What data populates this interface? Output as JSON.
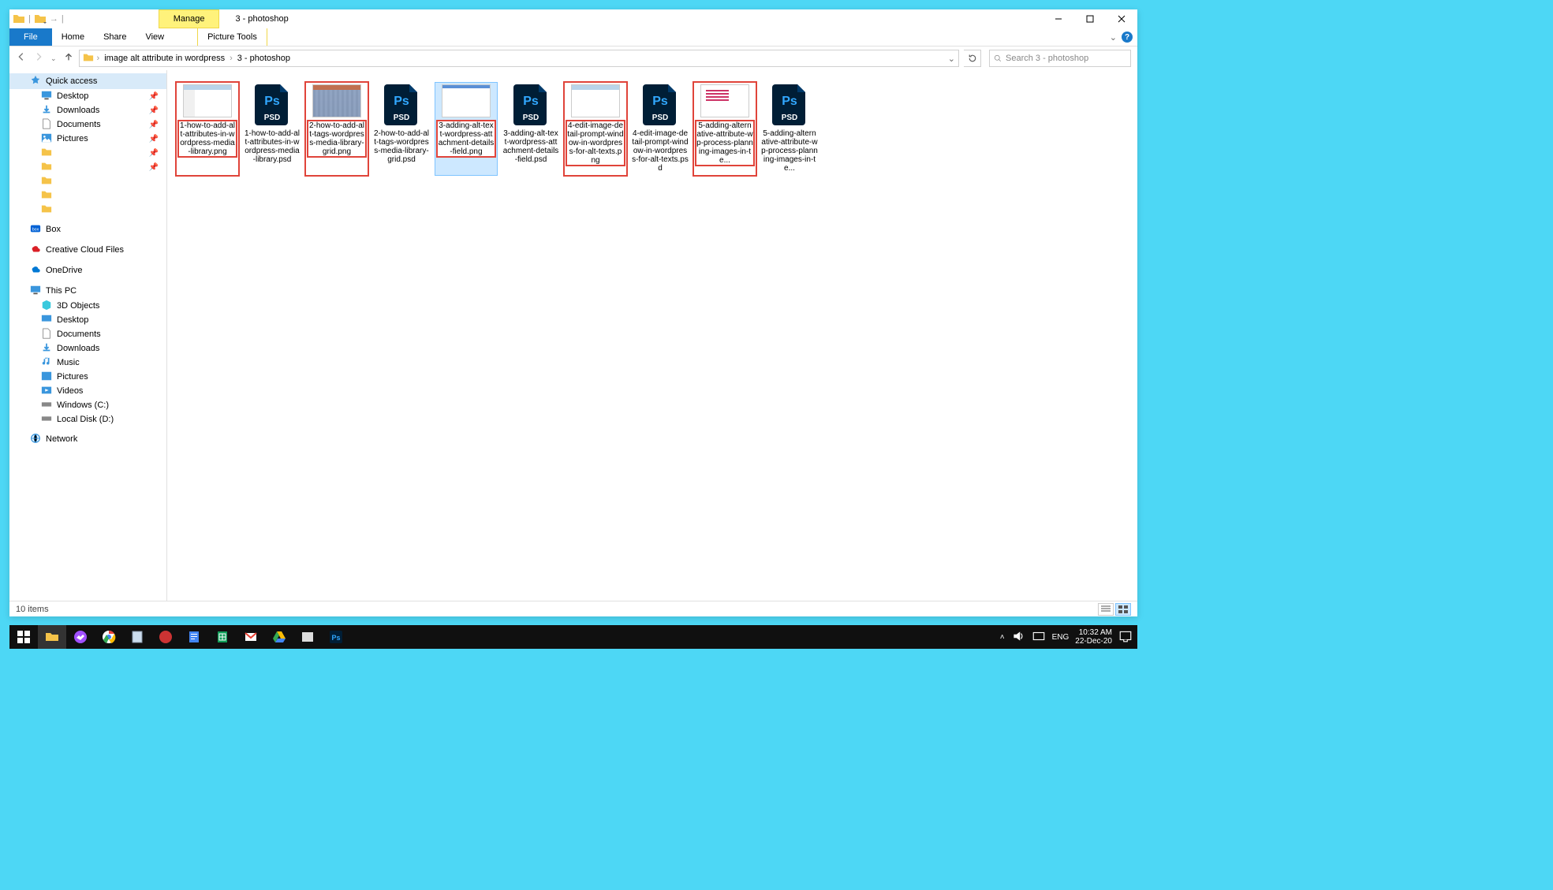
{
  "titlebar": {
    "manage_tab": "Manage",
    "window_title": "3 - photoshop"
  },
  "ribbon": {
    "file": "File",
    "home": "Home",
    "share": "Share",
    "view": "View",
    "picture_tools": "Picture Tools"
  },
  "breadcrumb": {
    "crumb1": "image alt attribute in wordpress",
    "crumb2": "3 - photoshop"
  },
  "search": {
    "placeholder": "Search 3 - photoshop"
  },
  "navpane": {
    "quick_access": "Quick access",
    "desktop": "Desktop",
    "downloads": "Downloads",
    "documents": "Documents",
    "pictures": "Pictures",
    "box": "Box",
    "creative_cloud": "Creative Cloud Files",
    "onedrive": "OneDrive",
    "this_pc": "This PC",
    "objects_3d": "3D Objects",
    "desktop2": "Desktop",
    "documents2": "Documents",
    "downloads2": "Downloads",
    "music": "Music",
    "pictures2": "Pictures",
    "videos": "Videos",
    "windows_c": "Windows (C:)",
    "local_d": "Local Disk (D:)",
    "network": "Network"
  },
  "files": [
    {
      "name": "1-how-to-add-alt-attributes-in-wordpress-media-library.png",
      "type": "png",
      "highlight": true,
      "thumb": "t1"
    },
    {
      "name": "1-how-to-add-alt-attributes-in-wordpress-media-library.psd",
      "type": "psd",
      "highlight": false
    },
    {
      "name": "2-how-to-add-alt-tags-wordpress-media-library-grid.png",
      "type": "png",
      "highlight": true,
      "thumb": "t2"
    },
    {
      "name": "2-how-to-add-alt-tags-wordpress-media-library-grid.psd",
      "type": "psd",
      "highlight": false
    },
    {
      "name": "3-adding-alt-text-wordpress-attachment-details-field.png",
      "type": "png",
      "highlight": true,
      "thumb": "t3",
      "selected": true
    },
    {
      "name": "3-adding-alt-text-wordpress-attachment-details-field.psd",
      "type": "psd",
      "highlight": false
    },
    {
      "name": "4-edit-image-detail-prompt-window-in-wordpress-for-alt-texts.png",
      "type": "png",
      "highlight": true,
      "thumb": "t4"
    },
    {
      "name": "4-edit-image-detail-prompt-window-in-wordpress-for-alt-texts.psd",
      "type": "psd",
      "highlight": false
    },
    {
      "name": "5-adding-alternative-attribute-wp-process-planning-images-in-te...",
      "type": "png",
      "highlight": true,
      "thumb": "t5"
    },
    {
      "name": "5-adding-alternative-attribute-wp-process-planning-images-in-te...",
      "type": "psd",
      "highlight": false
    }
  ],
  "statusbar": {
    "item_count": "10 items"
  },
  "taskbar": {
    "lang": "ENG",
    "time": "10:32 AM",
    "date": "22-Dec-20"
  }
}
